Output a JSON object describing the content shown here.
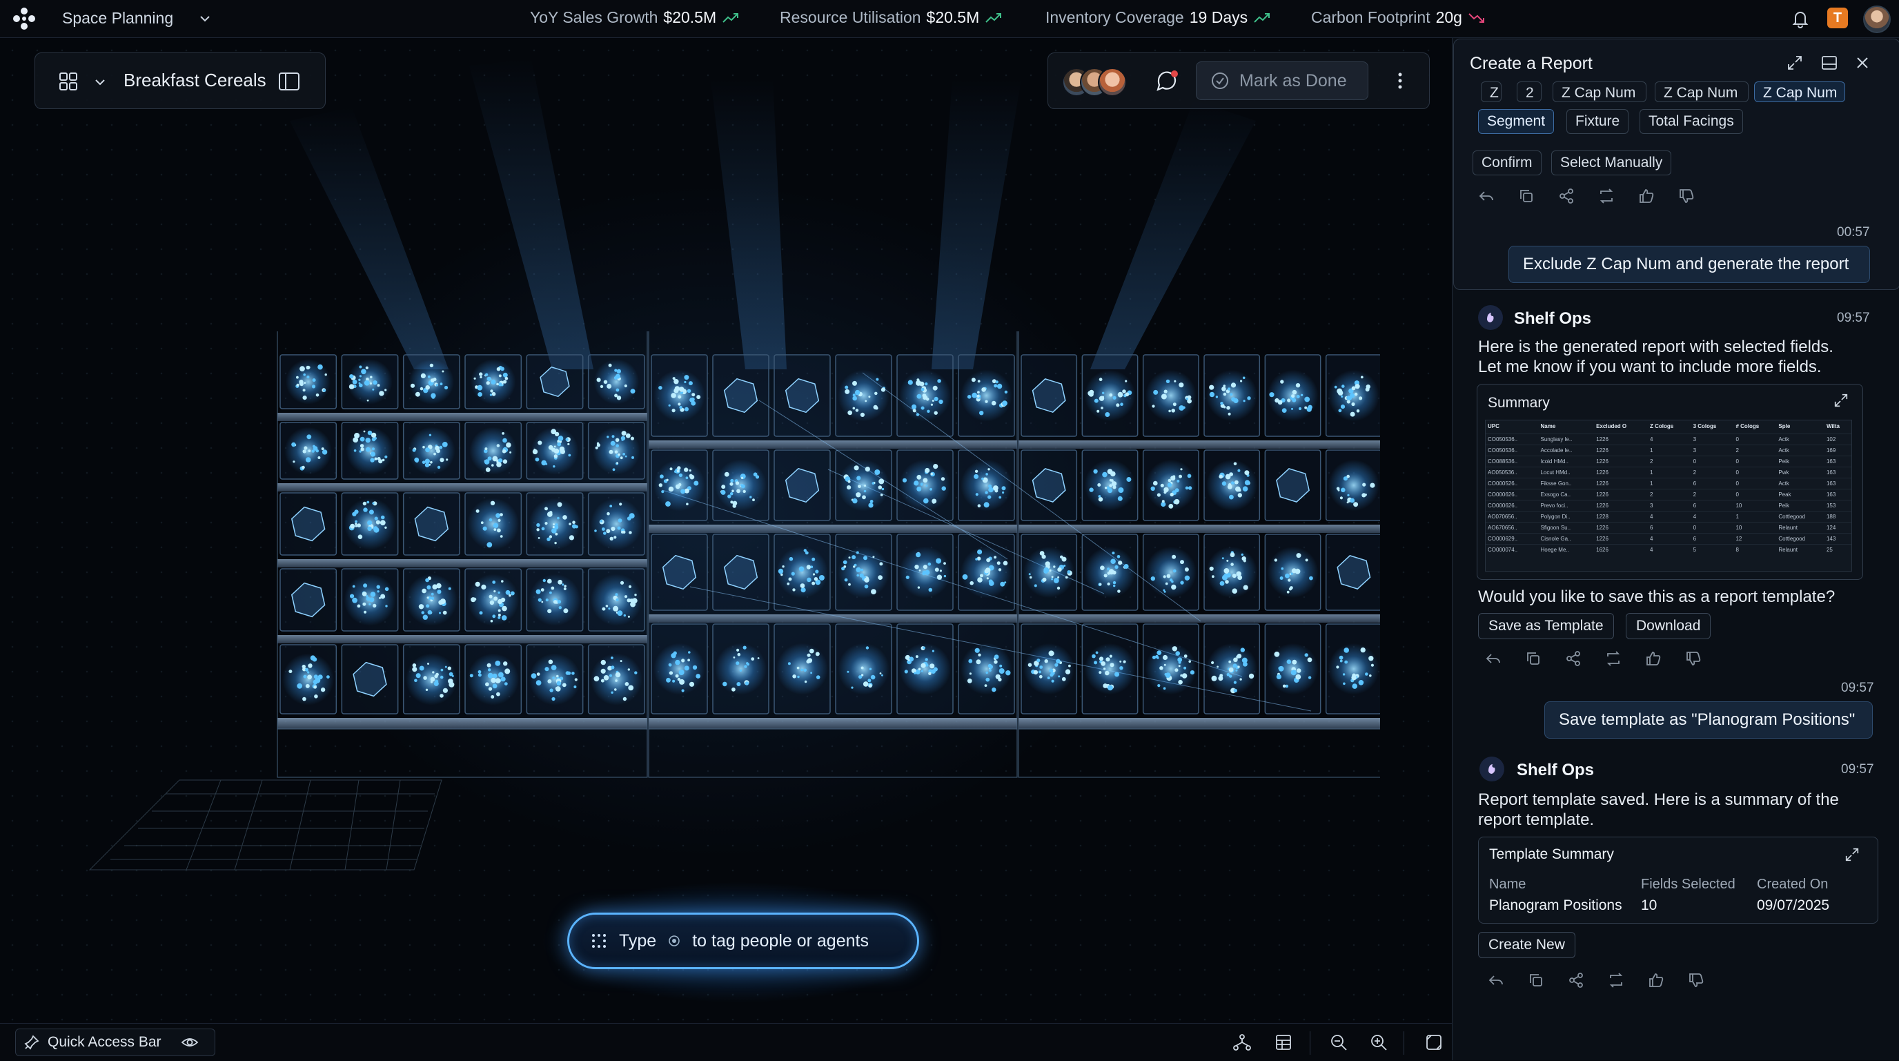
{
  "app": {
    "name": "Space Planning"
  },
  "kpis": [
    {
      "label": "YoY Sales Growth",
      "value": "$20.5M",
      "trend": "up"
    },
    {
      "label": "Resource Utilisation",
      "value": "$20.5M",
      "trend": "up"
    },
    {
      "label": "Inventory Coverage",
      "value": "19 Days",
      "trend": "up"
    },
    {
      "label": "Carbon Footprint",
      "value": "20g",
      "trend": "down"
    }
  ],
  "colors": {
    "trend_up": "#3fbf8a",
    "trend_down": "#e2467a",
    "accent": "#5bb4ff",
    "user_badge": "#e77a22"
  },
  "header": {
    "user_initial": "T"
  },
  "view": {
    "title": "Breakfast Cereals"
  },
  "collab": {
    "mark_done_label": "Mark as Done"
  },
  "prompt": {
    "before": "Type",
    "after": "to tag people or agents"
  },
  "quick_access": {
    "label": "Quick Access Bar"
  },
  "panel": {
    "title": "Create a Report",
    "cut_chips": [
      "Z",
      "2",
      "Z Cap Num",
      "Z Cap Num",
      "Z Cap Num"
    ],
    "field_chips": [
      {
        "label": "Segment",
        "selected": true
      },
      {
        "label": "Fixture",
        "selected": false
      },
      {
        "label": "Total Facings",
        "selected": false
      }
    ],
    "confirm_label": "Confirm",
    "select_manually_label": "Select Manually",
    "time_1": "00:57",
    "user_msg_1": "Exclude Z Cap Num and generate the report",
    "bot_name": "Shelf Ops",
    "time_2": "09:57",
    "bot_msg_1_line1": "Here is the generated report with selected fields.",
    "bot_msg_1_line2": "Let me know if you want to include more fields.",
    "summary_title": "Summary",
    "summary_columns": [
      "UPC",
      "Name",
      "Excluded O",
      "Z Cologs",
      "3 Cologs",
      "# Cologs",
      "Sple",
      "Wilta"
    ],
    "summary_rows": [
      [
        "CO050536..",
        "Sunglasy le..",
        "1226",
        "4",
        "3",
        "0",
        "Actk",
        "102"
      ],
      [
        "CO050536..",
        "Accolade le..",
        "1226",
        "1",
        "3",
        "2",
        "Actk",
        "169"
      ],
      [
        "CO088536..",
        "Icoid HMd..",
        "1226",
        "2",
        "0",
        "0",
        "Peik",
        "163"
      ],
      [
        "AO050536..",
        "Locut HMd..",
        "1226",
        "1",
        "2",
        "0",
        "Pwk",
        "163"
      ],
      [
        "CO000526..",
        "Fiksse Gon..",
        "1226",
        "1",
        "6",
        "0",
        "Actk",
        "163"
      ],
      [
        "CO000626..",
        "Exsogo Ca..",
        "1226",
        "2",
        "2",
        "0",
        "Peak",
        "163"
      ],
      [
        "CO000626..",
        "Prevo foci..",
        "1226",
        "3",
        "6",
        "10",
        "Peik",
        "153"
      ],
      [
        "AO070656..",
        "Polygon Di..",
        "1228",
        "4",
        "4",
        "1",
        "Cottlegood",
        "188"
      ],
      [
        "AO670656..",
        "Sfigoon Su..",
        "1226",
        "6",
        "0",
        "10",
        "Relaunt",
        "124"
      ],
      [
        "CO000629..",
        "Cisnole Ga..",
        "1226",
        "4",
        "6",
        "12",
        "Cottlegood",
        "143"
      ],
      [
        "CO000074..",
        "Hoege Me..",
        "1626",
        "4",
        "5",
        "8",
        "Relaunt",
        "25"
      ]
    ],
    "save_prompt": "Would you like to save this as a report template?",
    "save_template_label": "Save as Template",
    "download_label": "Download",
    "time_3": "09:57",
    "user_msg_2": "Save template as \"Planogram Positions\"",
    "time_4": "09:57",
    "bot_msg_2_line1": "Report template saved. Here is a summary of the",
    "bot_msg_2_line2": "report template.",
    "template_summary": {
      "title": "Template Summary",
      "h_name": "Name",
      "h_fields": "Fields Selected",
      "h_created": "Created On",
      "name": "Planogram Positions",
      "fields": "10",
      "created": "09/07/2025"
    },
    "create_new_label": "Create New"
  }
}
